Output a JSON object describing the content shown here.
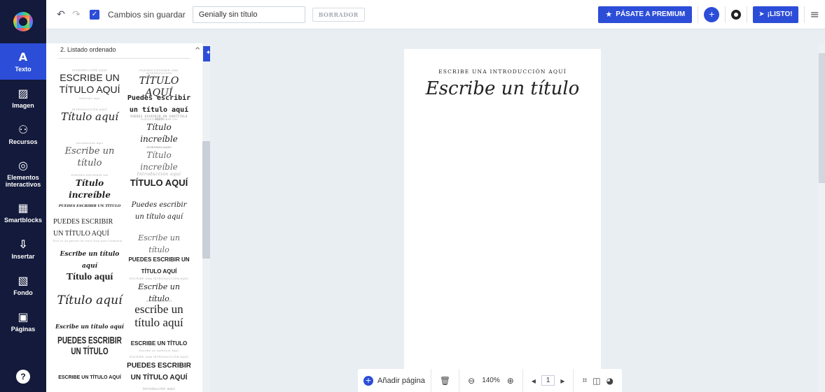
{
  "rail": {
    "items": [
      {
        "icon": "text-icon",
        "glyph": "A",
        "label": "Texto"
      },
      {
        "icon": "image-icon",
        "glyph": "▨",
        "label": "Imagen"
      },
      {
        "icon": "resources-icon",
        "glyph": "⚇",
        "label": "Recursos"
      },
      {
        "icon": "interactive-icon",
        "glyph": "◎",
        "label1": "Elementos",
        "label2": "interactivos"
      },
      {
        "icon": "smartblocks-icon",
        "glyph": "▦",
        "label": "Smartblocks"
      },
      {
        "icon": "insert-icon",
        "glyph": "⇩",
        "label": "Insertar"
      },
      {
        "icon": "background-icon",
        "glyph": "▧",
        "label": "Fondo"
      },
      {
        "icon": "pages-icon",
        "glyph": "▣",
        "label": "Páginas"
      }
    ],
    "help": "?"
  },
  "topbar": {
    "undo": "↶",
    "redo": "↷",
    "check": "✓",
    "unsaved": "Cambios sin guardar",
    "title_value": "Genially sin título",
    "draft": "BORRADOR",
    "premium": "PÁSATE A PREMIUM",
    "premium_icon": "★",
    "ready": "¡LISTO!",
    "ready_icon": "➤",
    "menu": "≡",
    "avatar": "+"
  },
  "panel": {
    "heading": "2. Listado ordenado",
    "templates": [
      {
        "sub": "INTRODUCCIÓN AQUÍ",
        "title": "ESCRIBE UN TÍTULO AQUÍ",
        "note": "Subtítulo aquí"
      },
      {
        "sub": "PUEDES ESCRIBIR UNA INTRODUCCIÓN",
        "title": "TÍTULO AQUÍ"
      },
      {
        "title": "Puedes escribir un título aquí",
        "note": "PUEDES ESCRIBIR UN SUBTÍTULO AQUÍ"
      },
      {
        "sub": "INTRODUCCIÓN AQUÍ",
        "title": "Título aquí"
      },
      {
        "sub": "PUEDES ESCRIBIR UN",
        "title": "Título increíble",
        "note": "Subtítulo aquí"
      },
      {
        "sub": "Introducción aquí",
        "title": "Escribe un título"
      },
      {
        "sub": "INTRODUCCIÓN",
        "title": "Título increíble"
      },
      {
        "sub": "PUEDES ESCRIBIR UN",
        "title": "Título increíble"
      },
      {
        "sub": "Introducción aquí",
        "title": "TÍTULO AQUÍ"
      },
      {
        "title": "PUEDES ESCRIBIR UN TÍTULO"
      },
      {
        "title": "Puedes escribir un título aquí"
      },
      {
        "title": "PUEDES ESCRIBIR UN TÍTULO AQUÍ",
        "note": "Este es un párrafo de texto listo para formatear"
      },
      {
        "title": "Escribe un título"
      },
      {
        "title": "Escribe un título aquí"
      },
      {
        "title": "PUEDES ESCRIBIR UN TÍTULO AQUÍ"
      },
      {
        "title": "Título aquí"
      },
      {
        "sub": "ESCRIBE UNA INTRODUCCIÓN AQUÍ",
        "title": "Escribe un título"
      },
      {
        "title": "Título aquí"
      },
      {
        "sub": "INTRODUCCIÓN",
        "title": "escribe un título aquí"
      },
      {
        "title": "Escribe un título aquí"
      },
      {
        "title": "ESCRIBE UN TÍTULO",
        "note": "Escribe un subtítulo aquí"
      },
      {
        "title": "PUEDES ESCRIBIR UN TÍTULO"
      },
      {
        "sub": "ESCRIBE UNA INTRODUCCIÓN AQUÍ",
        "title": "PUEDES ESCRIBIR UN TÍTULO AQUÍ"
      },
      {
        "title": "ESCRIBE UN TÍTULO AQUÍ"
      },
      {
        "sub": "Introducción aquí"
      }
    ]
  },
  "slide": {
    "intro": "ESCRIBE UNA INTRODUCCIÓN AQUÍ",
    "title": "Escribe un título"
  },
  "bottombar": {
    "add_page": "Añadir página",
    "add_icon": "+",
    "delete_icon": "🗑",
    "zoom_out": "⊖",
    "zoom": "140%",
    "zoom_in": "⊕",
    "prev": "◂",
    "page": "1",
    "next": "▸",
    "grid_icon": "⌗",
    "split_icon": "◫",
    "palette_icon": "◕"
  },
  "colors": {
    "accent": "#2c4dd8",
    "rail": "#131a3b",
    "workspace": "#e9eef3"
  }
}
